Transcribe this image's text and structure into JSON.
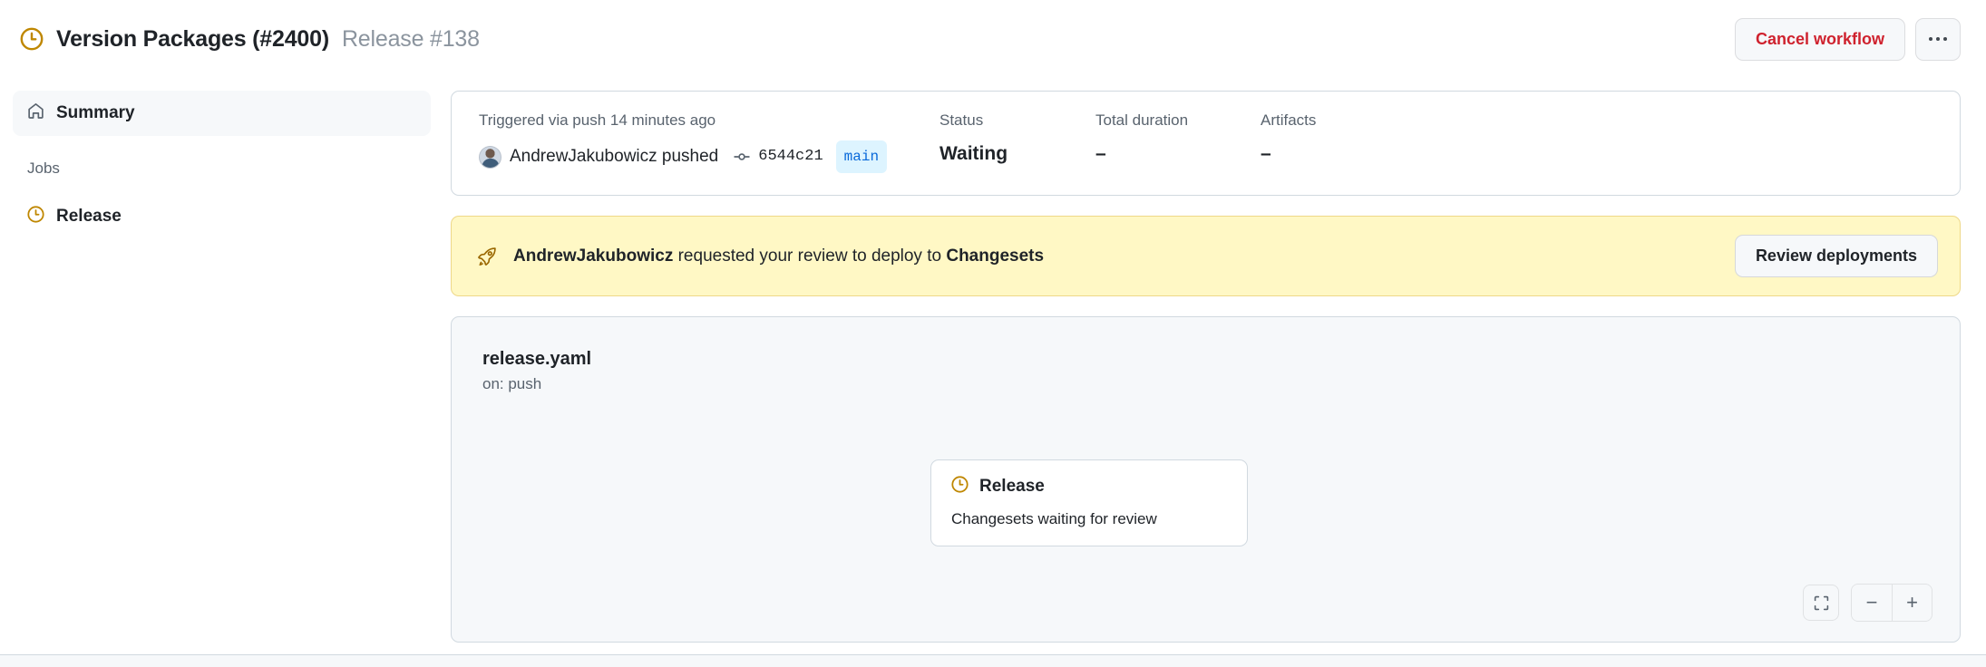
{
  "header": {
    "status_icon": "clock-icon",
    "title": "Version Packages (#2400)",
    "subtitle": "Release #138",
    "cancel_label": "Cancel workflow",
    "kebab_icon": "kebab-horizontal-icon"
  },
  "sidebar": {
    "summary": {
      "icon": "home-icon",
      "label": "Summary"
    },
    "jobs_section_label": "Jobs",
    "jobs": [
      {
        "icon": "clock-icon",
        "label": "Release"
      }
    ]
  },
  "info": {
    "trigger_label": "Triggered via push 14 minutes ago",
    "actor": "AndrewJakubowicz pushed",
    "commit_icon": "git-commit-icon",
    "commit_sha": "6544c21",
    "branch": "main",
    "status_label": "Status",
    "status_value": "Waiting",
    "duration_label": "Total duration",
    "duration_value": "–",
    "artifacts_label": "Artifacts",
    "artifacts_value": "–"
  },
  "review_banner": {
    "icon": "rocket-icon",
    "actor": "AndrewJakubowicz",
    "message_middle": " requested your review to deploy to ",
    "environment": "Changesets",
    "button_label": "Review deployments"
  },
  "graph": {
    "workflow_file": "release.yaml",
    "workflow_trigger": "on: push",
    "nodes": [
      {
        "icon": "clock-icon",
        "title": "Release",
        "subtitle": "Changesets waiting for review"
      }
    ],
    "controls": {
      "fit_icon": "fit-screen-icon",
      "zoom_out_label": "−",
      "zoom_in_label": "+"
    }
  },
  "colors": {
    "pending": "#bf8700",
    "danger": "#cf222e",
    "accent": "#0969da",
    "banner_bg": "#fff8c5",
    "panel_bg": "#f6f8fa",
    "border": "#d1d9e0"
  }
}
